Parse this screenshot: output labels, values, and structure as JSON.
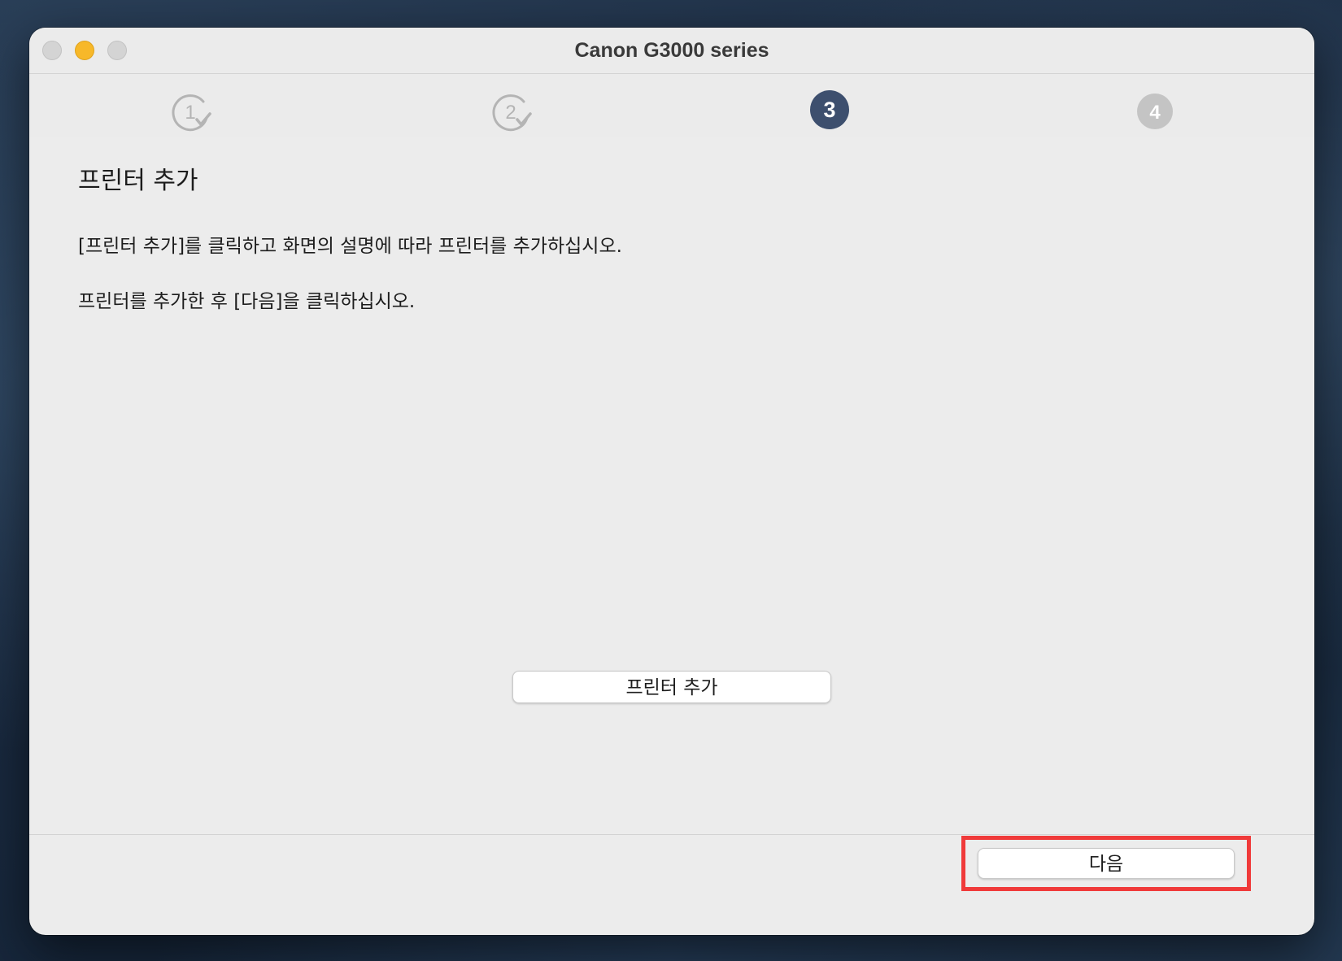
{
  "window": {
    "title": "Canon G3000 series"
  },
  "steps": {
    "items": [
      {
        "number": "1",
        "state": "completed"
      },
      {
        "number": "2",
        "state": "completed"
      },
      {
        "number": "3",
        "state": "current"
      },
      {
        "number": "4",
        "state": "pending"
      }
    ],
    "progress": 0.75
  },
  "main": {
    "heading": "프린터 추가",
    "instruction_1": "[프린터 추가]를 클릭하고 화면의 설명에 따라 프린터를 추가하십시오.",
    "instruction_2": "프린터를 추가한 후 [다음]을 클릭하십시오.",
    "add_printer_label": "프린터 추가"
  },
  "footer": {
    "next_label": "다음"
  },
  "colors": {
    "accent": "#3d4f6e",
    "highlight": "#f03a3a",
    "minimize": "#f7b829"
  }
}
